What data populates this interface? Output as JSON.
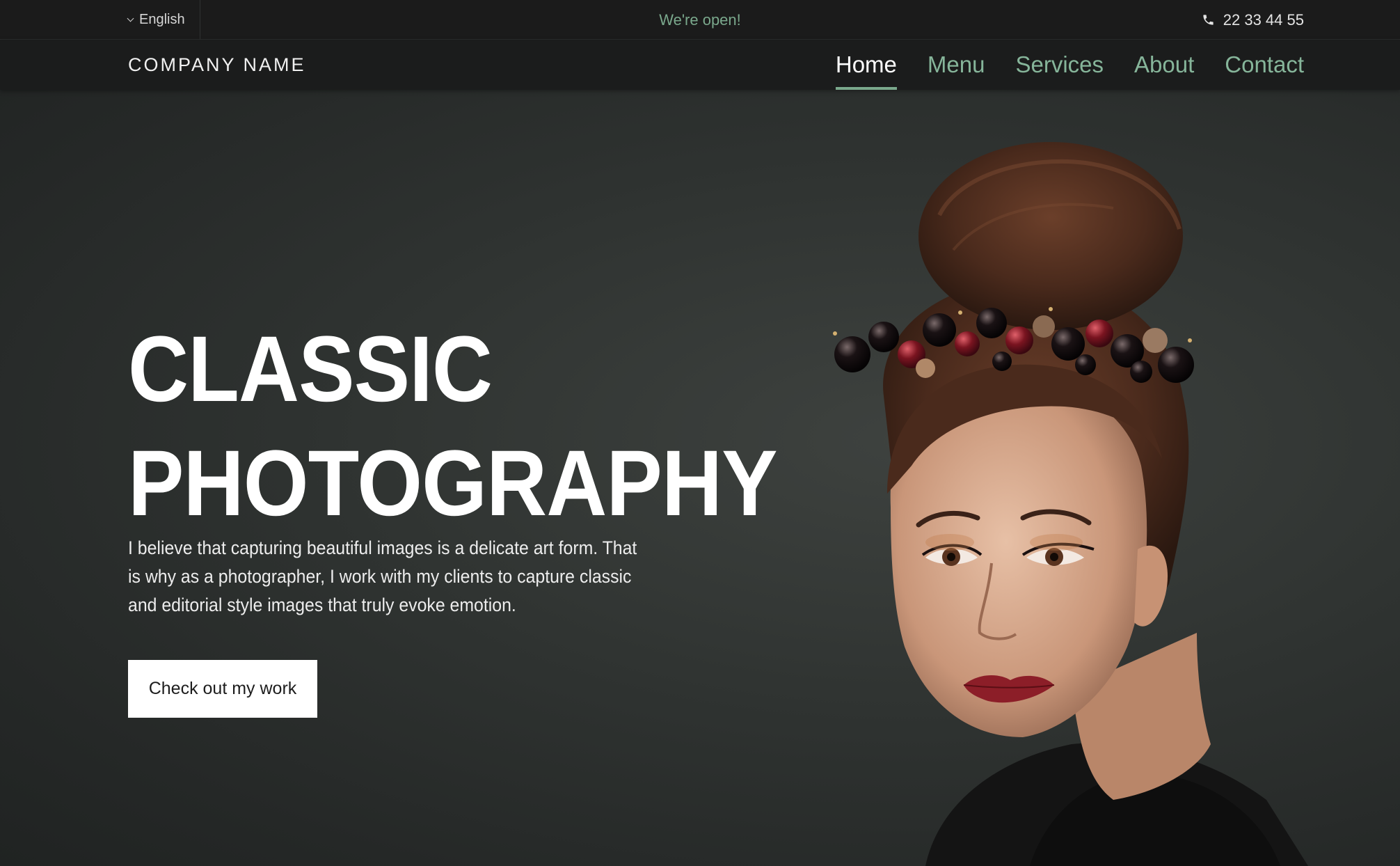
{
  "topbar": {
    "language": "English",
    "status": "We're open!",
    "phone": "22 33 44 55"
  },
  "navbar": {
    "brand": "COMPANY NAME",
    "items": [
      {
        "label": "Home",
        "active": true
      },
      {
        "label": "Menu",
        "active": false
      },
      {
        "label": "Services",
        "active": false
      },
      {
        "label": "About",
        "active": false
      },
      {
        "label": "Contact",
        "active": false
      }
    ]
  },
  "hero": {
    "title_line1": "CLASSIC",
    "title_line2": "PHOTOGRAPHY",
    "description": "I believe that capturing beautiful images is a delicate art form. That is why as a photographer, I work with my clients to capture classic and editorial style images that truly evoke emotion.",
    "cta_label": "Check out my work"
  },
  "colors": {
    "accent": "#7aa88c",
    "nav_link": "#86b59a",
    "bar_background": "#1b1b1b",
    "hero_background": "#2f3331"
  },
  "icons": {
    "language": "chevron-down-icon",
    "phone": "phone-icon"
  }
}
